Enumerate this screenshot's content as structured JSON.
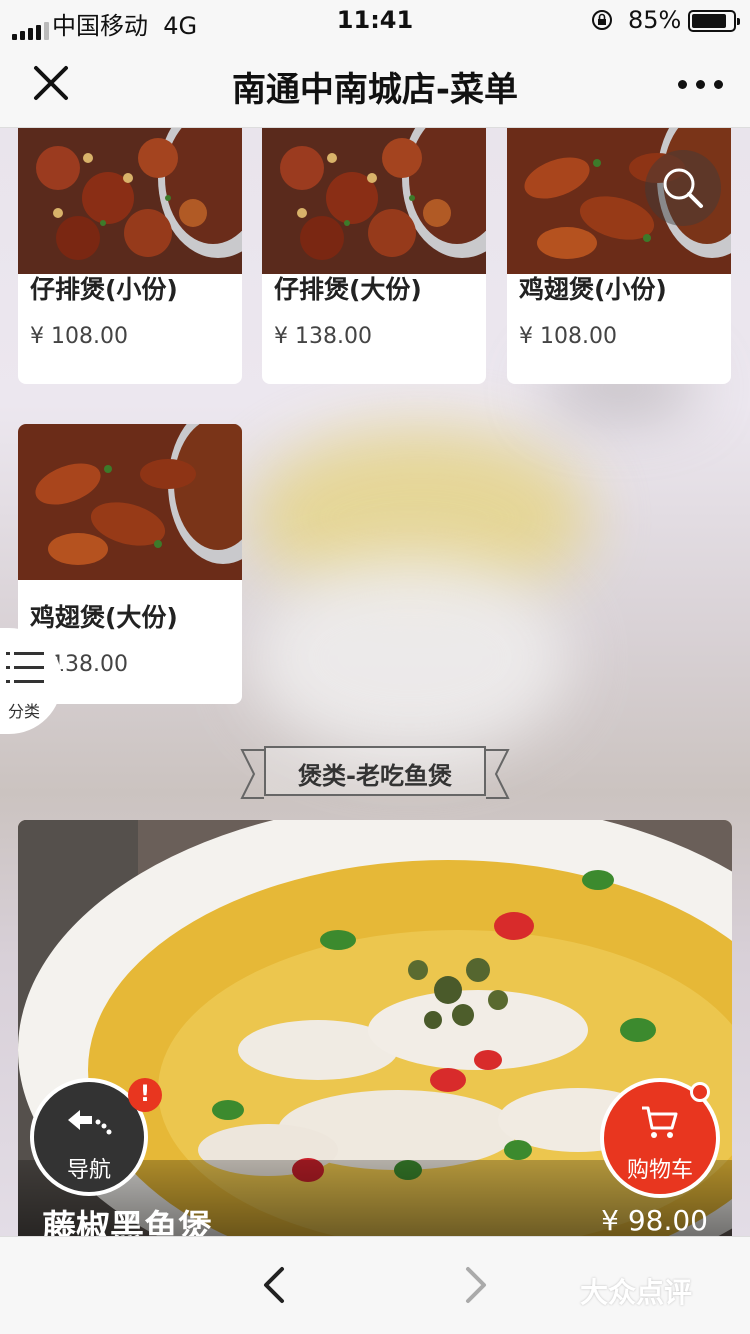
{
  "status_bar": {
    "carrier": "中国移动",
    "network": "4G",
    "time": "11:41",
    "battery": "85%",
    "battery_level": 0.85
  },
  "nav": {
    "title": "南通中南城店-菜单",
    "close_icon": "close-icon",
    "more_icon": "more-icon"
  },
  "menu_items": [
    {
      "name": "仔排煲(小份)",
      "price": "¥ 108.00"
    },
    {
      "name": "仔排煲(大份)",
      "price": "¥ 138.00"
    },
    {
      "name": "鸡翅煲(小份)",
      "price": "¥ 108.00"
    },
    {
      "name": "鸡翅煲(大份)",
      "price": "¥ 138.00"
    }
  ],
  "category_button": {
    "label": "分类"
  },
  "section": {
    "title": "煲类-老吃鱼煲"
  },
  "featured": {
    "name": "藤椒黑鱼煲",
    "price": "¥ 98.00"
  },
  "floating": {
    "nav_label": "导航",
    "nav_alert": "!",
    "cart_label": "购物车"
  },
  "watermark": "大众点评",
  "colors": {
    "accent": "#e8361f",
    "dark": "#333333"
  }
}
